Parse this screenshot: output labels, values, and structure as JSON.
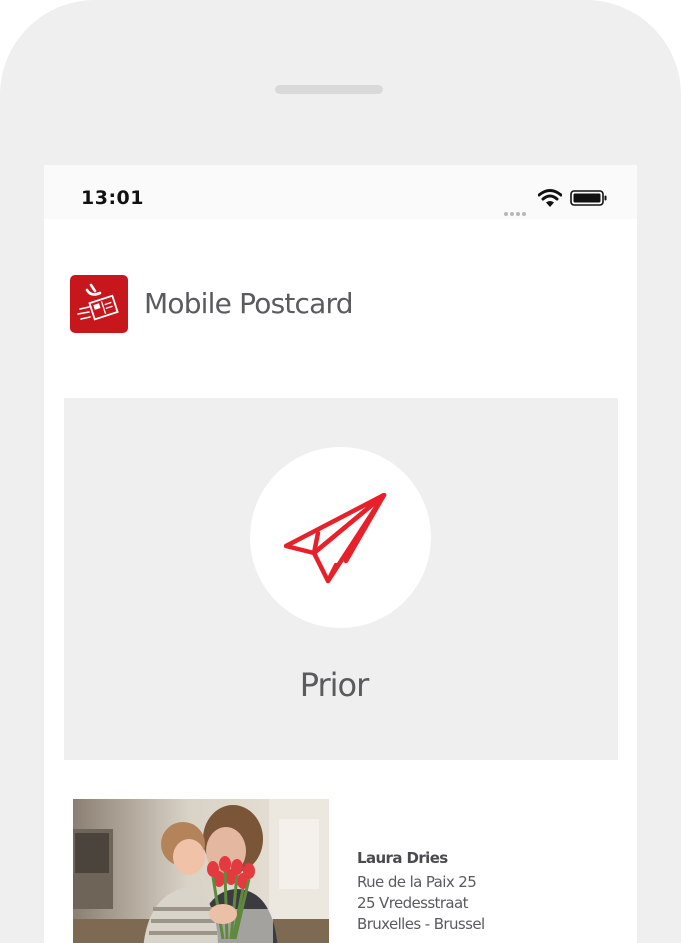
{
  "status_bar": {
    "time": "13:01"
  },
  "app": {
    "title": "Mobile Postcard",
    "logo_icon": "postcard-logo-icon",
    "brand_color": "#c8161d"
  },
  "option": {
    "label": "Prior",
    "icon": "paper-plane-icon",
    "icon_color": "#e8202a"
  },
  "recipient": {
    "name": "Laura Dries",
    "line1": "Rue de la Paix 25",
    "line2": "25 Vredesstraat",
    "line3": "Bruxelles - Brussel"
  }
}
